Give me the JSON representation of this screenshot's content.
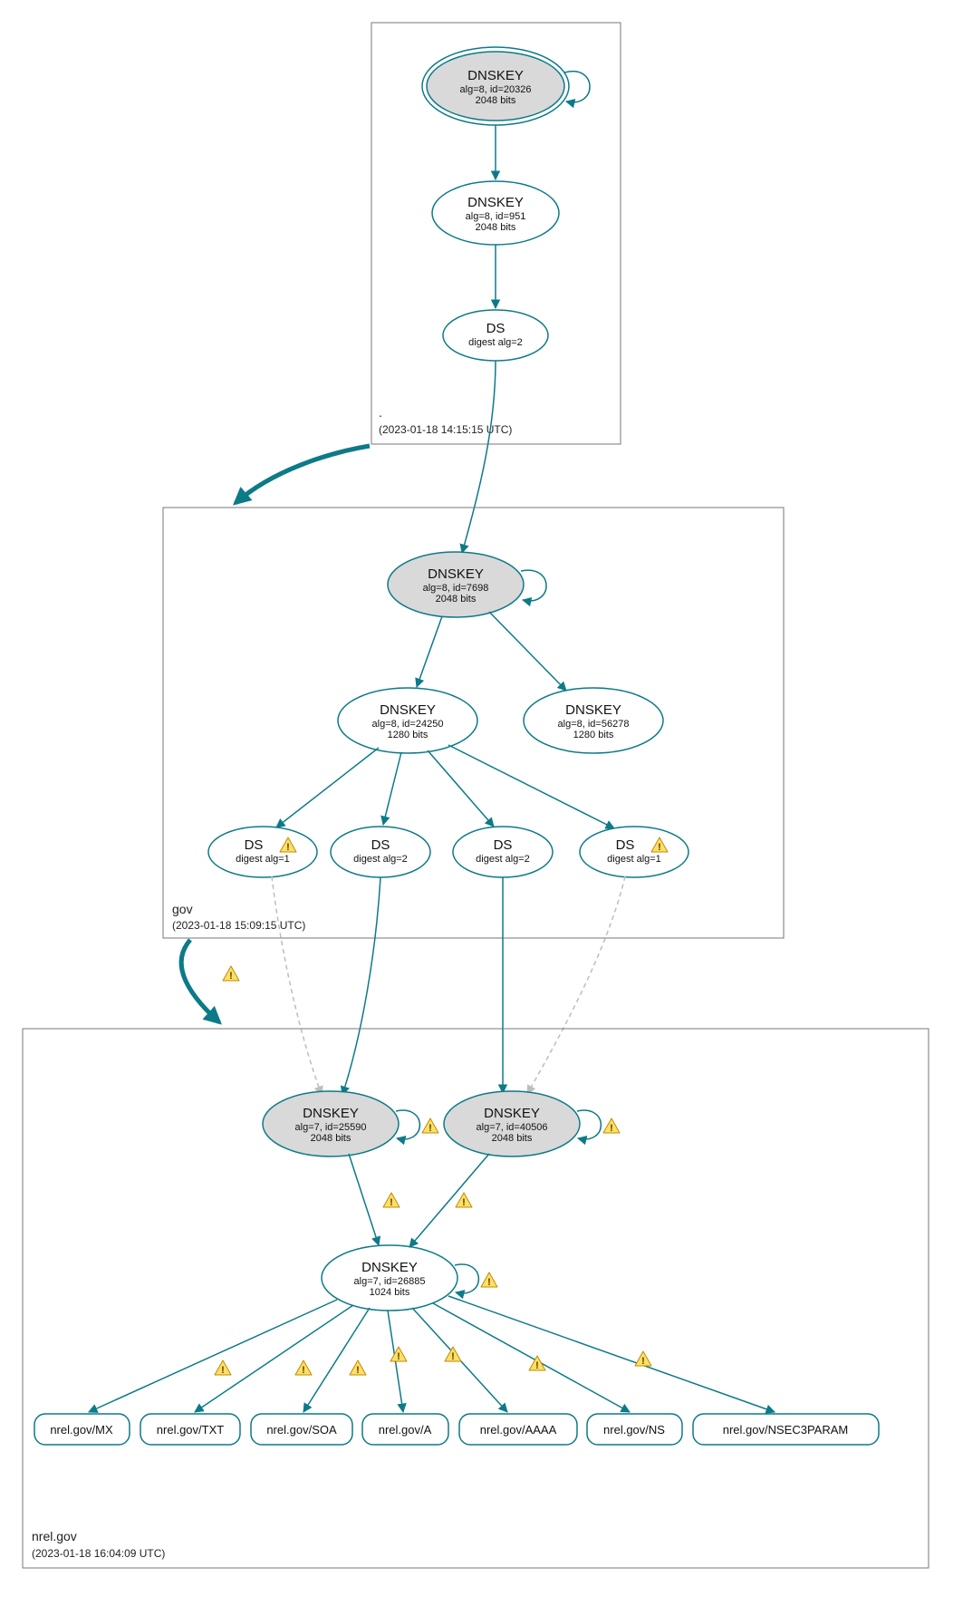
{
  "colors": {
    "teal": "#0d7a87",
    "greyFill": "#d9d9d9",
    "warnFill": "#ffe066",
    "warnStroke": "#c08a00"
  },
  "zones": {
    "root": {
      "name": ".",
      "timestamp": "(2023-01-18 14:15:15 UTC)"
    },
    "gov": {
      "name": "gov",
      "timestamp": "(2023-01-18 15:09:15 UTC)"
    },
    "nrel": {
      "name": "nrel.gov",
      "timestamp": "(2023-01-18 16:04:09 UTC)"
    }
  },
  "nodes": {
    "root_ksk": {
      "title": "DNSKEY",
      "line2": "alg=8, id=20326",
      "line3": "2048 bits"
    },
    "root_zsk": {
      "title": "DNSKEY",
      "line2": "alg=8, id=951",
      "line3": "2048 bits"
    },
    "root_ds": {
      "title": "DS",
      "line2": "digest alg=2"
    },
    "gov_ksk": {
      "title": "DNSKEY",
      "line2": "alg=8, id=7698",
      "line3": "2048 bits"
    },
    "gov_zsk": {
      "title": "DNSKEY",
      "line2": "alg=8, id=24250",
      "line3": "1280 bits"
    },
    "gov_zsk2": {
      "title": "DNSKEY",
      "line2": "alg=8, id=56278",
      "line3": "1280 bits"
    },
    "gov_ds1": {
      "title": "DS",
      "line2": "digest alg=1"
    },
    "gov_ds2": {
      "title": "DS",
      "line2": "digest alg=2"
    },
    "gov_ds3": {
      "title": "DS",
      "line2": "digest alg=2"
    },
    "gov_ds4": {
      "title": "DS",
      "line2": "digest alg=1"
    },
    "nrel_ksk1": {
      "title": "DNSKEY",
      "line2": "alg=7, id=25590",
      "line3": "2048 bits"
    },
    "nrel_ksk2": {
      "title": "DNSKEY",
      "line2": "alg=7, id=40506",
      "line3": "2048 bits"
    },
    "nrel_zsk": {
      "title": "DNSKEY",
      "line2": "alg=7, id=26885",
      "line3": "1024 bits"
    }
  },
  "rrsets": {
    "mx": "nrel.gov/MX",
    "txt": "nrel.gov/TXT",
    "soa": "nrel.gov/SOA",
    "a": "nrel.gov/A",
    "aaaa": "nrel.gov/AAAA",
    "ns": "nrel.gov/NS",
    "nsec": "nrel.gov/NSEC3PARAM"
  }
}
